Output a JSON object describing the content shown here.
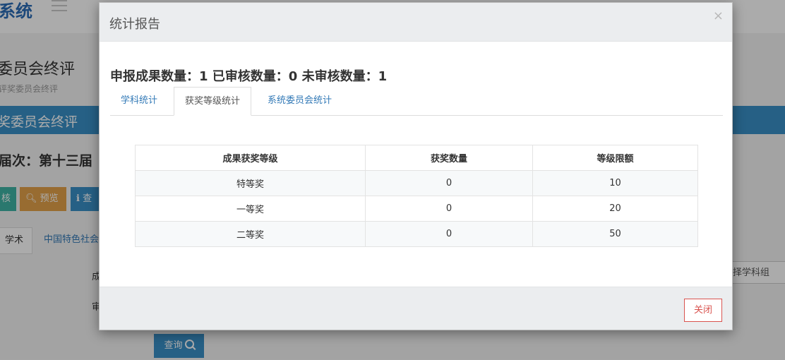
{
  "background": {
    "system_title": "系统",
    "page_title": "委员会终评",
    "page_subtitle": "评奖委员会终评",
    "blue_bar_title": "奖委员会终评",
    "session_label": "届次：第十三届",
    "buttons": {
      "audit": "核",
      "preview": "预览",
      "view": "查"
    },
    "tabs": [
      "学术",
      "中国特色社会"
    ],
    "labels": [
      "成",
      "审"
    ],
    "select_placeholder": "选择学科组",
    "query_button": "查询"
  },
  "modal": {
    "title": "统计报告",
    "close_symbol": "×",
    "summary": "申报成果数量：1 已审核数量：0 未审核数量：1",
    "tabs": [
      {
        "label": "学科统计",
        "active": false
      },
      {
        "label": "获奖等级统计",
        "active": true
      },
      {
        "label": "系统委员会统计",
        "active": false
      }
    ],
    "table": {
      "headers": [
        "成果获奖等级",
        "获奖数量",
        "等级限额"
      ],
      "rows": [
        [
          "特等奖",
          "0",
          "10"
        ],
        [
          "一等奖",
          "0",
          "20"
        ],
        [
          "二等奖",
          "0",
          "50"
        ]
      ]
    },
    "close_button": "关闭"
  },
  "colors": {
    "primary": "#3a8fc7",
    "link": "#337ab7",
    "danger": "#d9534f",
    "preview": "#e3a24a",
    "audit": "#3fb3a4"
  }
}
